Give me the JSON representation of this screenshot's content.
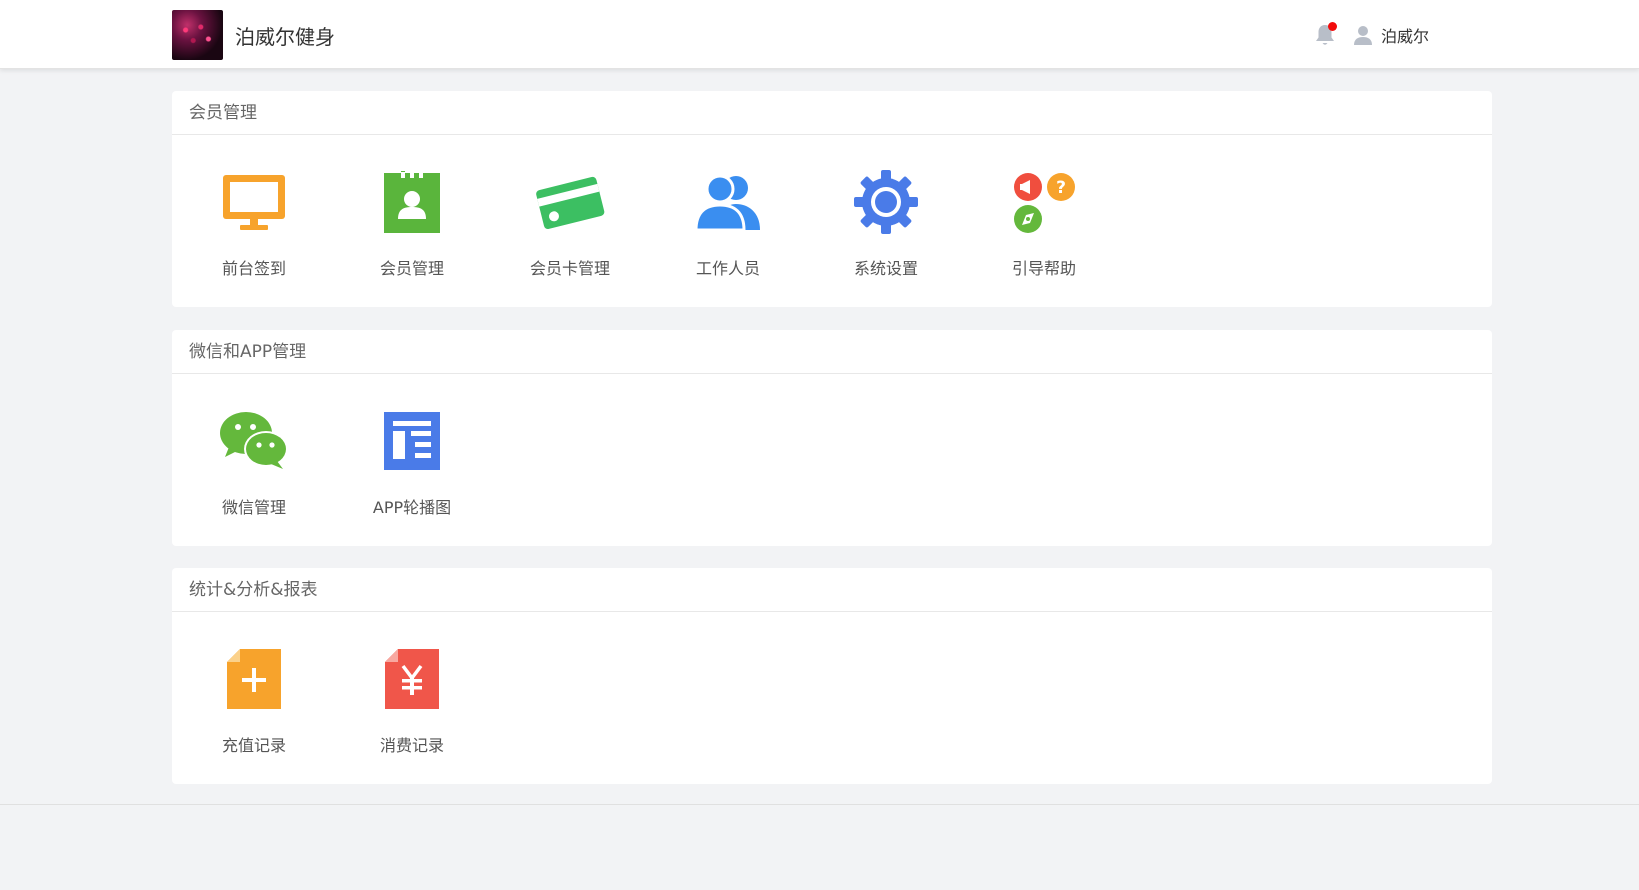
{
  "header": {
    "brand_name": "泊威尔健身",
    "user_name": "泊威尔",
    "has_notification": true
  },
  "sections": [
    {
      "title": "会员管理",
      "items": [
        {
          "label": "前台签到",
          "icon": "monitor-icon",
          "color": "#f7a32c"
        },
        {
          "label": "会员管理",
          "icon": "member-badge-icon",
          "color": "#5ab53c"
        },
        {
          "label": "会员卡管理",
          "icon": "card-icon",
          "color": "#3cbf62"
        },
        {
          "label": "工作人员",
          "icon": "staff-icon",
          "color": "#3a8ef0"
        },
        {
          "label": "系统设置",
          "icon": "gear-icon",
          "color": "#4a7be8"
        },
        {
          "label": "引导帮助",
          "icon": "guide-help-icon",
          "color": "#f04e3e"
        }
      ]
    },
    {
      "title": "微信和APP管理",
      "items": [
        {
          "label": "微信管理",
          "icon": "wechat-icon",
          "color": "#64b83c"
        },
        {
          "label": "APP轮播图",
          "icon": "carousel-icon",
          "color": "#4a7be8"
        }
      ]
    },
    {
      "title": "统计&分析&报表",
      "items": [
        {
          "label": "充值记录",
          "icon": "recharge-record-icon",
          "color": "#f7a32c"
        },
        {
          "label": "消费记录",
          "icon": "consume-record-icon",
          "color": "#f0564a"
        }
      ]
    }
  ]
}
